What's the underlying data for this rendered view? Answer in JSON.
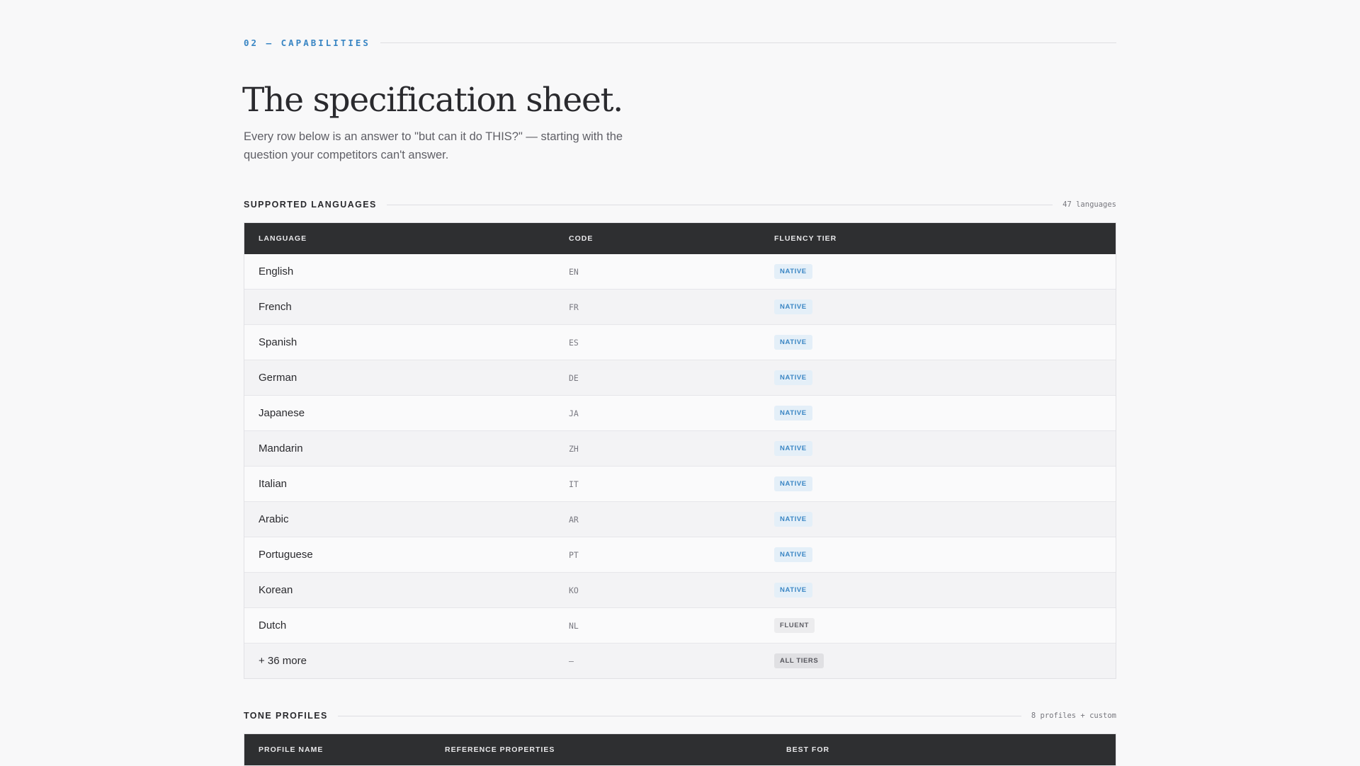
{
  "eyebrow": "02 — CAPABILITIES",
  "headline": "The specification sheet.",
  "lede": "Every row below is an answer to \"but can it do THIS?\" — starting with the question your competitors can't answer.",
  "languages": {
    "title": "SUPPORTED LANGUAGES",
    "meta": "47 languages",
    "columns": [
      "LANGUAGE",
      "CODE",
      "FLUENCY TIER"
    ],
    "rows": [
      {
        "name": "English",
        "code": "EN",
        "tier": "NATIVE"
      },
      {
        "name": "French",
        "code": "FR",
        "tier": "NATIVE"
      },
      {
        "name": "Spanish",
        "code": "ES",
        "tier": "NATIVE"
      },
      {
        "name": "German",
        "code": "DE",
        "tier": "NATIVE"
      },
      {
        "name": "Japanese",
        "code": "JA",
        "tier": "NATIVE"
      },
      {
        "name": "Mandarin",
        "code": "ZH",
        "tier": "NATIVE"
      },
      {
        "name": "Italian",
        "code": "IT",
        "tier": "NATIVE"
      },
      {
        "name": "Arabic",
        "code": "AR",
        "tier": "NATIVE"
      },
      {
        "name": "Portuguese",
        "code": "PT",
        "tier": "NATIVE"
      },
      {
        "name": "Korean",
        "code": "KO",
        "tier": "NATIVE"
      },
      {
        "name": "Dutch",
        "code": "NL",
        "tier": "FLUENT"
      },
      {
        "name": "+ 36 more",
        "code": "—",
        "tier": "ALL TIERS"
      }
    ]
  },
  "tones": {
    "title": "TONE PROFILES",
    "meta": "8 profiles + custom",
    "columns": [
      "PROFILE NAME",
      "REFERENCE PROPERTIES",
      "BEST FOR"
    ]
  },
  "colors": {
    "accent": "#3a86c4",
    "header_bg": "#2e2f31",
    "page_bg": "#f8f8f9"
  }
}
